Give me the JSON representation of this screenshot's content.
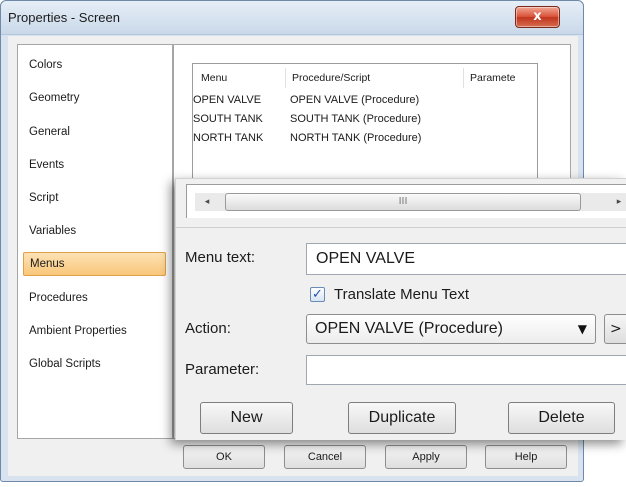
{
  "window": {
    "title": "Properties - Screen",
    "close_glyph": "x"
  },
  "sidebar": {
    "items": [
      {
        "label": "Colors"
      },
      {
        "label": "Geometry"
      },
      {
        "label": "General"
      },
      {
        "label": "Events"
      },
      {
        "label": "Script"
      },
      {
        "label": "Variables"
      },
      {
        "label": "Menus",
        "selected": true
      },
      {
        "label": "Procedures"
      },
      {
        "label": "Ambient Properties"
      },
      {
        "label": "Global Scripts"
      }
    ]
  },
  "menu_table": {
    "columns": [
      "Menu",
      "Procedure/Script",
      "Paramete"
    ],
    "rows": [
      [
        "OPEN VALVE",
        "OPEN VALVE (Procedure)"
      ],
      [
        "SOUTH TANK",
        "SOUTH TANK (Procedure)"
      ],
      [
        "NORTH TANK",
        "NORTH TANK (Procedure)"
      ]
    ]
  },
  "scrollbar": {
    "left_arrow": "◂",
    "right_arrow": "▸",
    "thumb_grip": "III"
  },
  "editor": {
    "menu_text_label": "Menu text:",
    "menu_text_value": "OPEN VALVE",
    "translate_label": "Translate Menu Text",
    "translate_checked": true,
    "checkmark": "✓",
    "action_label": "Action:",
    "action_value": "OPEN VALVE (Procedure)",
    "dropdown_arrow": "▼",
    "more_button": ">",
    "parameter_label": "Parameter:",
    "parameter_value": "",
    "new_button": "New",
    "duplicate_button": "Duplicate",
    "delete_button": "Delete"
  },
  "footer": {
    "ok": "OK",
    "cancel": "Cancel",
    "apply": "Apply",
    "help": "Help"
  },
  "colors": {
    "selection": "#f9c77a",
    "close_button": "#d9533a",
    "window_frame": "#d8e3ef"
  },
  "icons": [
    "close-icon",
    "checkbox-check-icon",
    "dropdown-arrow-icon",
    "scroll-left-arrow-icon",
    "scroll-right-arrow-icon"
  ]
}
